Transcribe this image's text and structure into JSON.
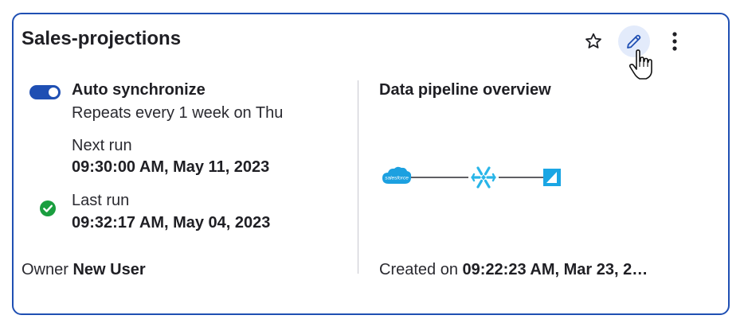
{
  "card": {
    "title": "Sales-projections",
    "colors": {
      "accent": "#1f4fb3",
      "success": "#1a9e3f",
      "salesforce": "#1ca0e0",
      "snowflake": "#29b5e8",
      "target": "#1aa6e4"
    }
  },
  "actions": {
    "star_icon": "star-icon",
    "edit_icon": "pencil-icon",
    "more_icon": "kebab-menu-icon"
  },
  "sync": {
    "toggle_on": true,
    "label": "Auto synchronize",
    "repeat_text": "Repeats every 1 week on Thu",
    "next_run_label": "Next run",
    "next_run_value": "09:30:00 AM, May 11, 2023",
    "last_run_label": "Last run",
    "last_run_value": "09:32:17 AM, May 04, 2023",
    "last_run_status": "success"
  },
  "owner": {
    "label": "Owner",
    "name": "New User"
  },
  "pipeline": {
    "title": "Data pipeline overview",
    "nodes": [
      {
        "name": "salesforce-logo",
        "logo_text": "salesforce"
      },
      {
        "name": "snowflake-logo"
      },
      {
        "name": "destination-logo"
      }
    ]
  },
  "created": {
    "label": "Created on",
    "value": "09:22:23 AM, Mar 23, 2…"
  }
}
